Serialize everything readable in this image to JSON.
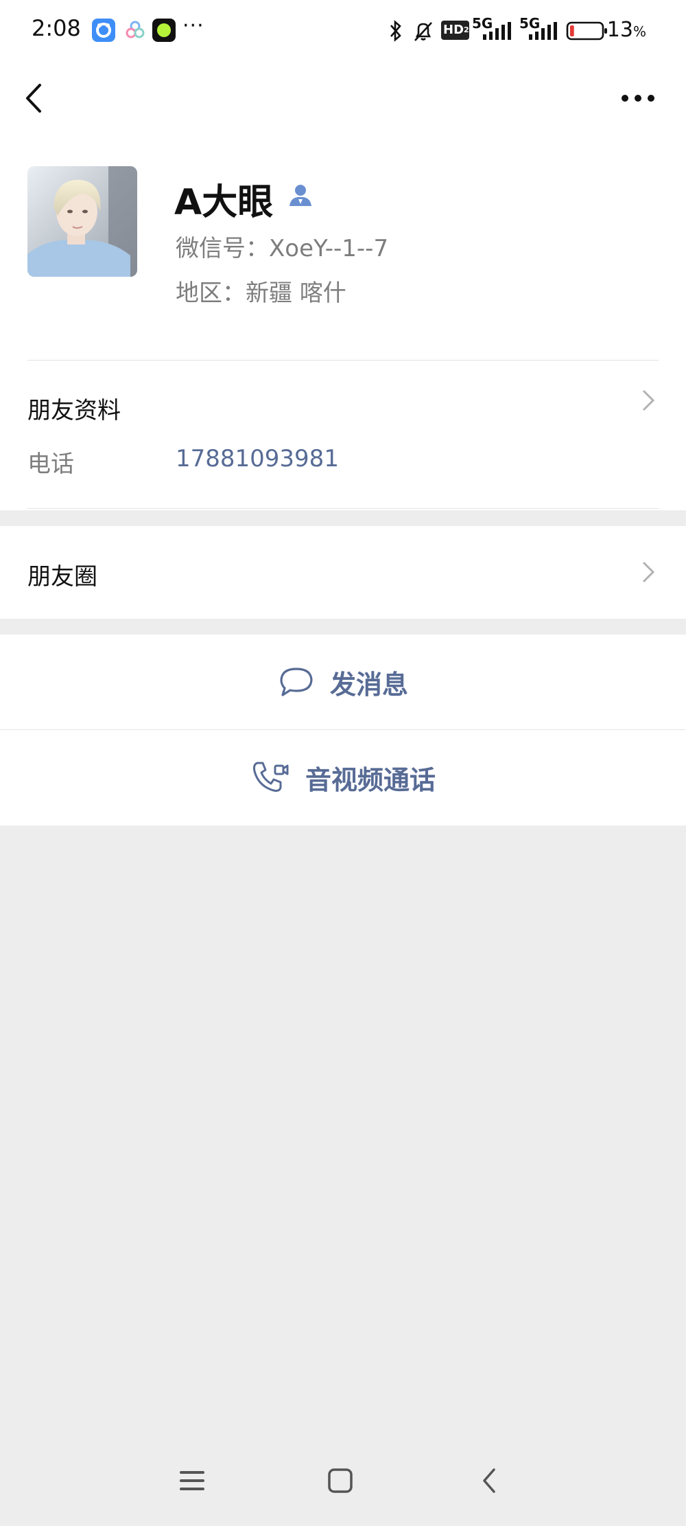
{
  "status_bar": {
    "time": "2:08",
    "more_dots": "···",
    "net_hd": "HD",
    "net_hd_sub": "2",
    "net_5g_1": "5G",
    "net_5g_2": "5G",
    "battery": "13",
    "battery_unit": "%",
    "battery_level": 0.13
  },
  "profile": {
    "name": "A大眼",
    "wechat_id": "微信号：XoeY--1--7",
    "region": "地区：新疆  喀什"
  },
  "friend_info": {
    "title": "朋友资料",
    "phone_label": "电话",
    "phone_value": "17881093981"
  },
  "moments": {
    "title": "朋友圈"
  },
  "actions": {
    "message_label": "发消息",
    "call_label": "音视频通话"
  },
  "colors": {
    "link": "#576b95",
    "background": "#ededed",
    "card": "#ffffff",
    "contact_icon": "#6a8fd1"
  }
}
